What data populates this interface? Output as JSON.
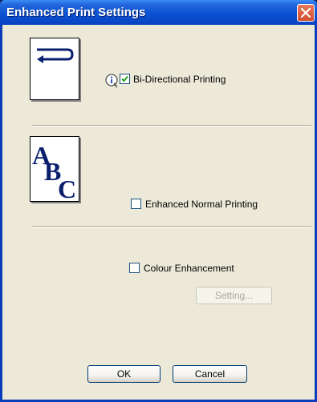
{
  "window": {
    "title": "Enhanced Print Settings"
  },
  "options": {
    "bidirectional": {
      "label": "Bi-Directional Printing",
      "checked": true
    },
    "enhanced_normal": {
      "label": "Enhanced Normal Printing",
      "checked": false
    },
    "colour_enhancement": {
      "label": "Colour Enhancement",
      "checked": false
    }
  },
  "preview_abc": {
    "letters": [
      "A",
      "B",
      "C"
    ]
  },
  "buttons": {
    "setting": "Setting...",
    "ok": "OK",
    "cancel": "Cancel"
  },
  "colors": {
    "title_bar": "#0a52d4",
    "dialog_bg": "#ece9d8",
    "check_mark": "#21a121",
    "close_button": "#d24d2c"
  },
  "icons": [
    "close-icon",
    "info-icon",
    "check-icon",
    "return-arrow-icon"
  ]
}
